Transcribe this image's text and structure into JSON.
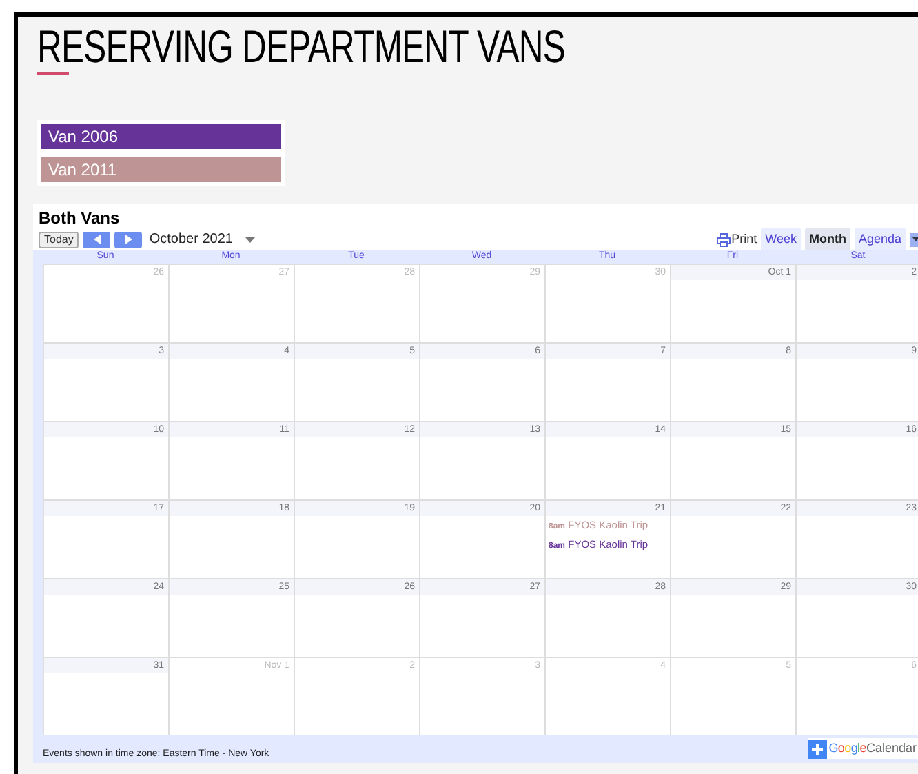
{
  "page_title": "RESERVING DEPARTMENT VANS",
  "vans": [
    {
      "name": "Van 2006",
      "color": "#663399"
    },
    {
      "name": "Van 2011",
      "color": "#be9494"
    }
  ],
  "calendar": {
    "title": "Both Vans",
    "toolbar": {
      "today": "Today",
      "month_label": "October 2021",
      "print": "Print",
      "views": [
        {
          "label": "Week",
          "selected": false
        },
        {
          "label": "Month",
          "selected": true
        },
        {
          "label": "Agenda",
          "selected": false
        }
      ]
    },
    "day_names": [
      "Sun",
      "Mon",
      "Tue",
      "Wed",
      "Thu",
      "Fri",
      "Sat"
    ],
    "weeks": [
      [
        {
          "label": "26",
          "in_month": false
        },
        {
          "label": "27",
          "in_month": false
        },
        {
          "label": "28",
          "in_month": false
        },
        {
          "label": "29",
          "in_month": false
        },
        {
          "label": "30",
          "in_month": false
        },
        {
          "label": "Oct 1",
          "in_month": true
        },
        {
          "label": "2",
          "in_month": true
        }
      ],
      [
        {
          "label": "3",
          "in_month": true
        },
        {
          "label": "4",
          "in_month": true
        },
        {
          "label": "5",
          "in_month": true
        },
        {
          "label": "6",
          "in_month": true
        },
        {
          "label": "7",
          "in_month": true
        },
        {
          "label": "8",
          "in_month": true
        },
        {
          "label": "9",
          "in_month": true
        }
      ],
      [
        {
          "label": "10",
          "in_month": true
        },
        {
          "label": "11",
          "in_month": true
        },
        {
          "label": "12",
          "in_month": true
        },
        {
          "label": "13",
          "in_month": true
        },
        {
          "label": "14",
          "in_month": true
        },
        {
          "label": "15",
          "in_month": true
        },
        {
          "label": "16",
          "in_month": true
        }
      ],
      [
        {
          "label": "17",
          "in_month": true
        },
        {
          "label": "18",
          "in_month": true
        },
        {
          "label": "19",
          "in_month": true
        },
        {
          "label": "20",
          "in_month": true
        },
        {
          "label": "21",
          "in_month": true,
          "events": [
            {
              "time": "8am",
              "title": "FYOS Kaolin Trip",
              "color": "#be9494"
            },
            {
              "time": "8am",
              "title": "FYOS Kaolin Trip",
              "color": "#663399"
            }
          ]
        },
        {
          "label": "22",
          "in_month": true
        },
        {
          "label": "23",
          "in_month": true
        }
      ],
      [
        {
          "label": "24",
          "in_month": true
        },
        {
          "label": "25",
          "in_month": true
        },
        {
          "label": "26",
          "in_month": true
        },
        {
          "label": "27",
          "in_month": true
        },
        {
          "label": "28",
          "in_month": true
        },
        {
          "label": "29",
          "in_month": true
        },
        {
          "label": "30",
          "in_month": true
        }
      ],
      [
        {
          "label": "31",
          "in_month": true
        },
        {
          "label": "Nov 1",
          "in_month": false
        },
        {
          "label": "2",
          "in_month": false
        },
        {
          "label": "3",
          "in_month": false
        },
        {
          "label": "4",
          "in_month": false
        },
        {
          "label": "5",
          "in_month": false
        },
        {
          "label": "6",
          "in_month": false
        }
      ]
    ],
    "footer": {
      "timezone": "Events shown in time zone: Eastern Time - New York",
      "brand_google": "Google",
      "brand_calendar": "Calendar"
    }
  }
}
